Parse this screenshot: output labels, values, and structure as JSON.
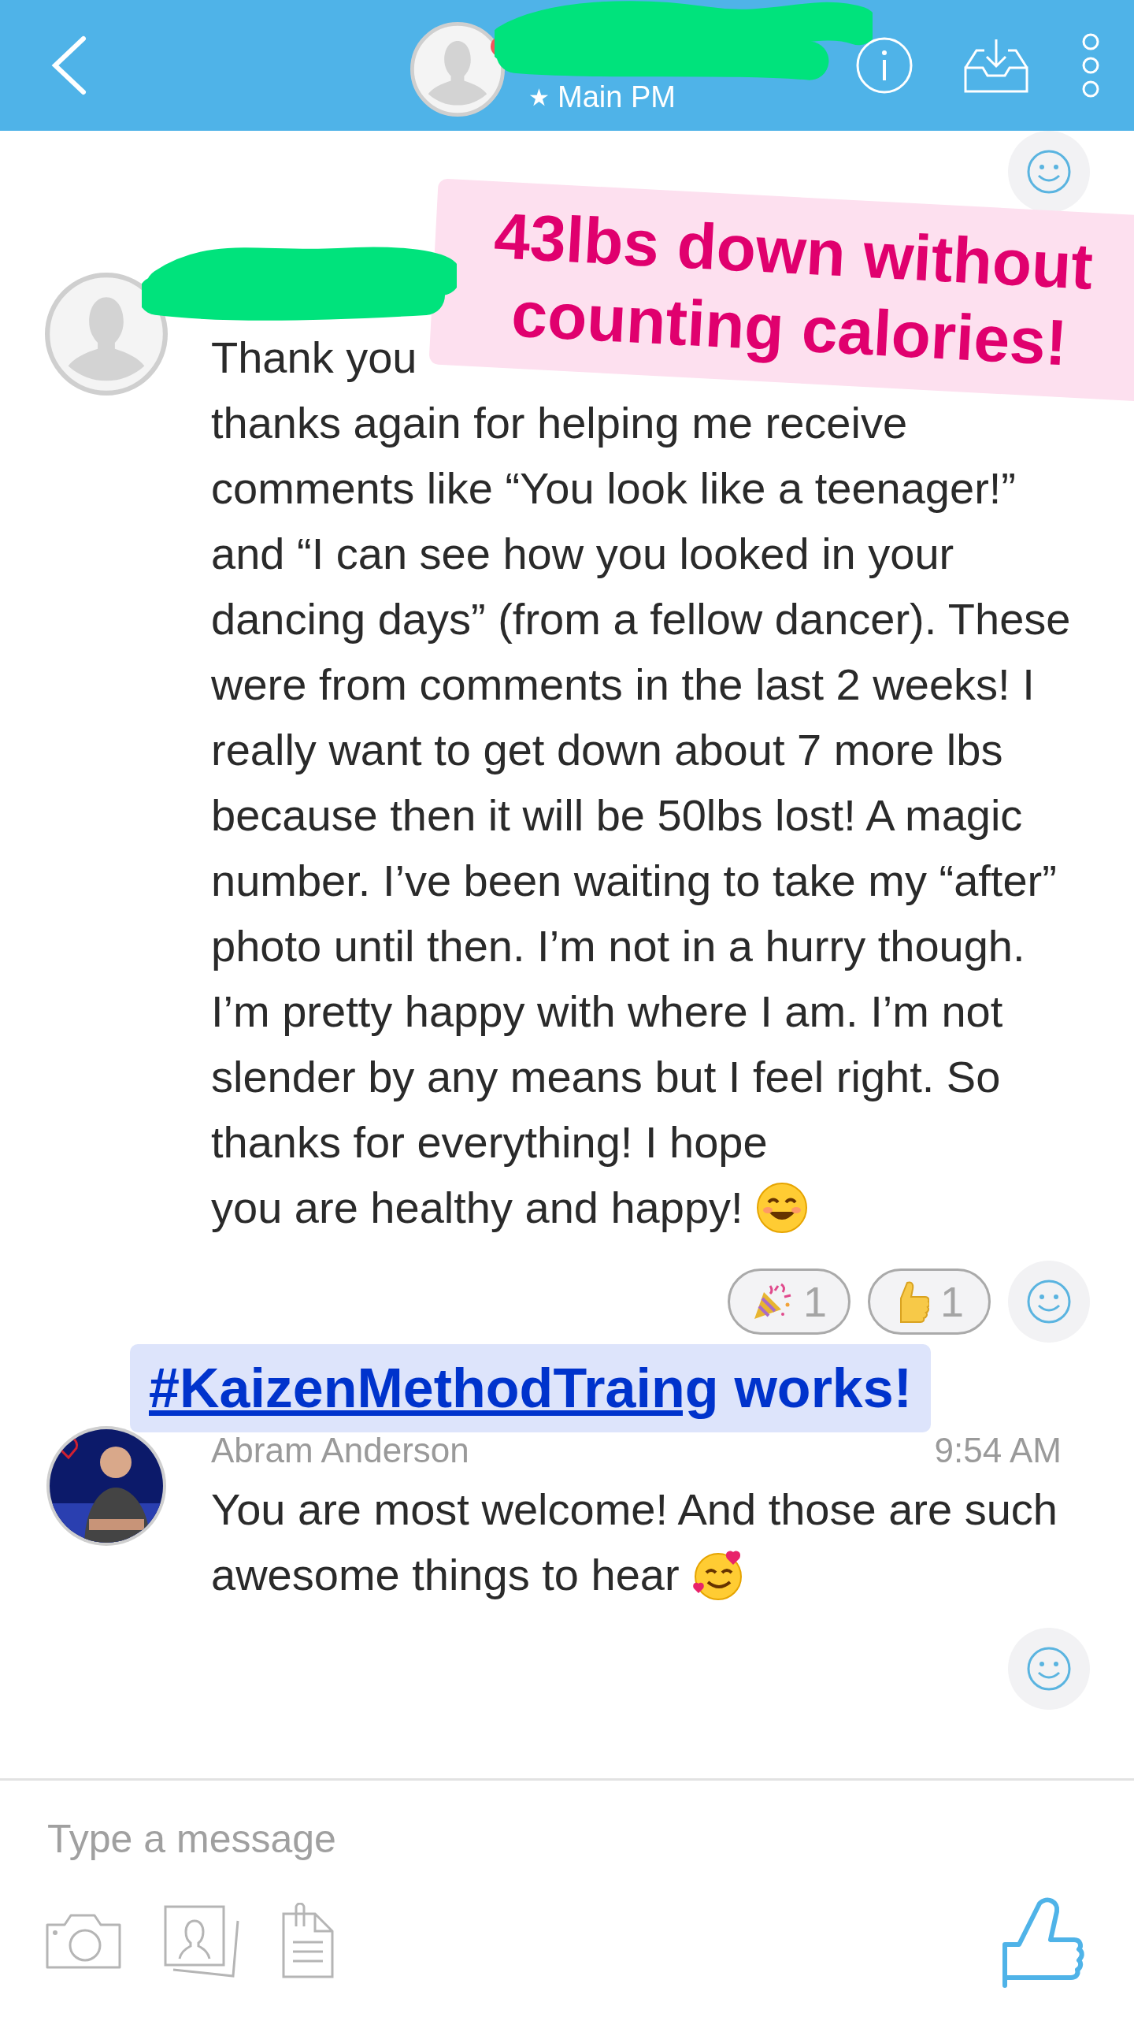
{
  "header": {
    "star": "★",
    "subtitle": "Main PM",
    "online": true
  },
  "messages": [
    {
      "avatar": {
        "kind": "placeholder"
      },
      "first_line": "Thank you",
      "text": "thanks again for helping me receive comments like “You look like a teenager!” and “I can see how you looked in your dancing days” (from a fellow dancer). These were from comments in the last 2 weeks! I really want to get down about 7 more lbs because then it will be 50lbs lost! A magic number. I’ve been waiting to take my “after” photo until then. I’m not in a hurry though. I’m pretty happy with where I am. I’m not slender by any means but I feel right. So thanks for everything! I hope",
      "last_line": "you are healthy and happy!",
      "emoji": {
        "kind": "smile"
      },
      "reactions": [
        {
          "kind": "party",
          "count": "1"
        },
        {
          "kind": "thumbs",
          "count": "1"
        }
      ]
    },
    {
      "sender": "Abram Anderson",
      "time": "9:54 AM",
      "text": "You are most welcome! And those are such",
      "last_line": "awesome things to hear",
      "emoji": {
        "kind": "hearts"
      }
    }
  ],
  "captions": [
    {
      "kind": "headline",
      "text": "43lbs down without counting calories!"
    },
    {
      "kind": "hashtag",
      "link": "#KaizenMethodTraing",
      "text": "works!"
    }
  ],
  "composer": {
    "placeholder": "Type a message"
  }
}
